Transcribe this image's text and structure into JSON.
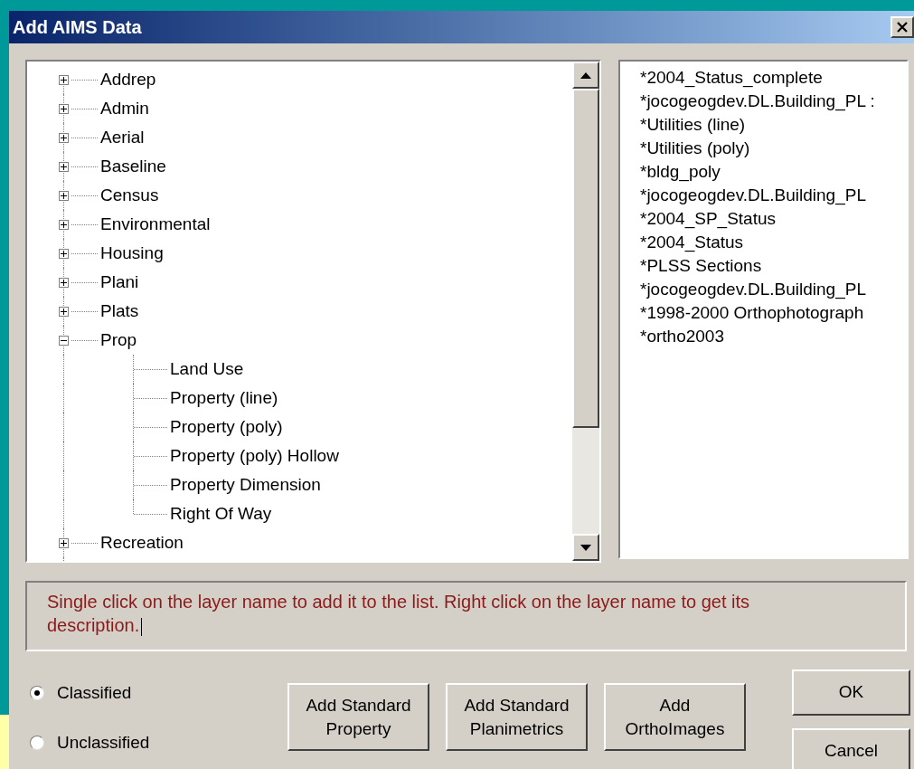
{
  "window": {
    "title": "Add AIMS Data"
  },
  "tree": {
    "items": [
      {
        "label": "Addrep",
        "expanded": false
      },
      {
        "label": "Admin",
        "expanded": false
      },
      {
        "label": "Aerial",
        "expanded": false
      },
      {
        "label": "Baseline",
        "expanded": false
      },
      {
        "label": "Census",
        "expanded": false
      },
      {
        "label": "Environmental",
        "expanded": false
      },
      {
        "label": "Housing",
        "expanded": false
      },
      {
        "label": "Plani",
        "expanded": false
      },
      {
        "label": "Plats",
        "expanded": false
      },
      {
        "label": "Prop",
        "expanded": true,
        "children": [
          {
            "label": "Land Use"
          },
          {
            "label": "Property (line)"
          },
          {
            "label": "Property (poly)"
          },
          {
            "label": "Property (poly) Hollow"
          },
          {
            "label": "Property Dimension"
          },
          {
            "label": "Right Of Way"
          }
        ]
      },
      {
        "label": "Recreation",
        "expanded": false
      }
    ]
  },
  "selected_layers": [
    "*2004_Status_complete",
    "*jocogeogdev.DL.Building_PL :",
    "*Utilities (line)",
    "*Utilities (poly)",
    "*bldg_poly",
    "*jocogeogdev.DL.Building_PL",
    "*2004_SP_Status",
    "*2004_Status",
    "*PLSS Sections",
    "*jocogeogdev.DL.Building_PL",
    "*1998-2000 Orthophotograph",
    "*ortho2003"
  ],
  "message": "Single click on the layer name to add it to the list. Right click on the layer name to get its description.",
  "radios": [
    {
      "label": "Classified",
      "selected": true
    },
    {
      "label": "Unclassified",
      "selected": false
    }
  ],
  "buttons": [
    {
      "lines": [
        "Add Standard",
        "Property"
      ]
    },
    {
      "lines": [
        "Add Standard",
        "Planimetrics"
      ]
    },
    {
      "lines": [
        "Add",
        "OrthoImages"
      ]
    }
  ],
  "ok": "OK",
  "cancel": "Cancel"
}
